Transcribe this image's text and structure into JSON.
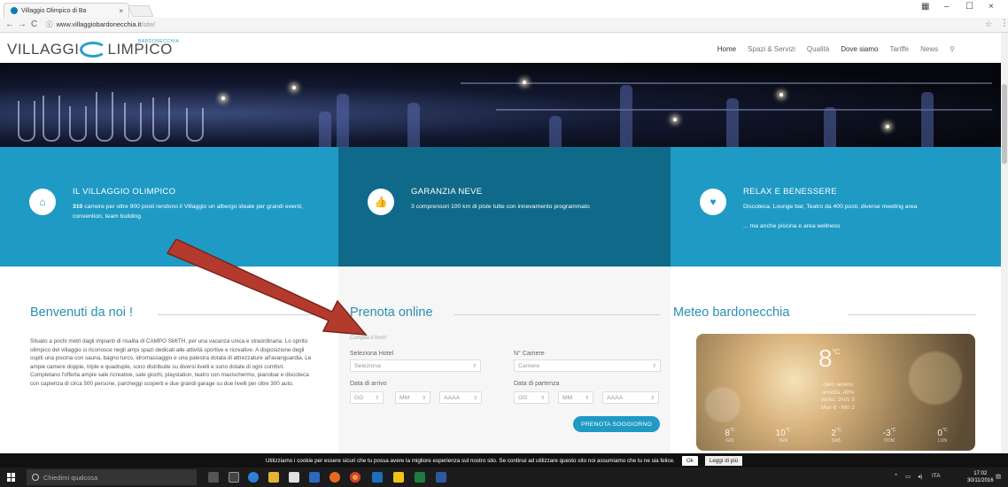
{
  "browser": {
    "tab_title": "Villaggio Olimpico di Ba",
    "tab_close": "×",
    "url_host": "www.villaggiobardonecchia.it",
    "url_path": "/site/",
    "back": "←",
    "forward": "→",
    "reload": "C",
    "info": "ⓘ",
    "star": "☆",
    "menu": "⋮",
    "win_user": "▦",
    "win_min": "–",
    "win_max": "☐",
    "win_close": "×"
  },
  "site": {
    "logo_left": "VILLAGGI",
    "logo_right": "LIMPICO",
    "logo_sup": "BARDONECCHIA",
    "nav": [
      "Home",
      "Spazi & Servizi",
      "Qualità",
      "Dove siamo",
      "Tariffe",
      "News"
    ],
    "search_icon": "magnifier-icon"
  },
  "features": [
    {
      "icon": "⌂",
      "title": "IL VILLAGGIO OLIMPICO",
      "text_bold": "310",
      "text": " camere per oltre 900 posti rendono il Villaggio un albergo ideale per grandi eventi, convention, team building"
    },
    {
      "icon": "👍",
      "title": "GARANZIA NEVE",
      "text_bold": "",
      "text": "3 comprensori 100 km di piste tutte con innevamento programmato"
    },
    {
      "icon": "♥",
      "title": "RELAX E BENESSERE",
      "text_bold": "",
      "text": "Discoteca, Lounge bar, Teatro da 400 posti, diverse meeting area",
      "text2": "... ma anche piscina e area wellness"
    }
  ],
  "welcome": {
    "title": "Benvenuti da noi !",
    "text": "Situato a pochi metri dagli impianti di risalita di CAMPO SMITH, per una vacanza unica e straordinaria. Lo spirito olimpico del villaggio si riconosce negli ampi spazi dedicati alle attività sportive e ricreative. A disposizione degli ospiti una piscina con sauna, bagno turco, idromassaggio e una palestra dotata di attrezzature all'avanguardia. Le ampie camere doppie, triple e quadruple, sono distribuite su diversi livelli e sono dotate di ogni comfort. Completano l'offerta ampie sale ricreative, sale giochi, playstation, teatro con maxischermo, pianobar e discoteca con capienza di circa 500 persone, parcheggi scoperti e due grandi garage su due livelli per oltre 300 auto."
  },
  "booking": {
    "title": "Prenota online",
    "hint": "Compila il form!",
    "hotel_label": "Seleziona Hotel",
    "hotel_value": "Seleziona",
    "rooms_label": "N° Camere",
    "rooms_value": "Camere",
    "arrival_label": "Data di arrivo",
    "departure_label": "Data di partenza",
    "dd": "GG",
    "mm": "MM",
    "yyyy": "AAAA",
    "button": "PRENOTA SOGGIORNO"
  },
  "weather": {
    "title": "Meteo bardonecchia",
    "temp": "8",
    "unit": "°C",
    "desc": [
      "cielo sereno",
      "umidità: 49%",
      "vento: 2m/s S",
      "Max 8 - Min 2"
    ],
    "days": [
      {
        "t": "8",
        "d": "GIO"
      },
      {
        "t": "10",
        "d": "VEN"
      },
      {
        "t": "2",
        "d": "SAB"
      },
      {
        "t": "-3",
        "d": "DOM"
      },
      {
        "t": "0",
        "d": "LUN"
      }
    ]
  },
  "cookie": {
    "text": "Utilizziamo i cookie per essere sicuri che tu possa avere la migliore esperienza sul nostro sito. Se continui ad utilizzare questo sito noi assumiamo che tu ne sia felice.",
    "ok": "Ok",
    "more": "Leggi di più"
  },
  "taskbar": {
    "search": "Chiedimi qualcosa",
    "lang": "ITA",
    "time": "17:02",
    "date": "30/11/2016"
  },
  "colors": {
    "accent": "#1e9ac5",
    "accent_dark": "#0f6a89",
    "arrow": "#b53a2e"
  }
}
